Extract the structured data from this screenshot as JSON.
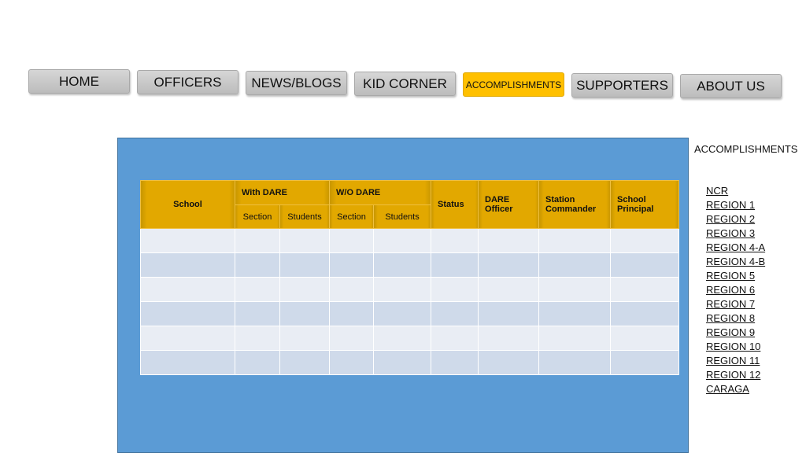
{
  "nav": {
    "items": [
      {
        "label": "HOME"
      },
      {
        "label": "OFFICERS"
      },
      {
        "label": "NEWS/BLOGS"
      },
      {
        "label": "KID CORNER"
      },
      {
        "label": "ACCOMPLISHMENTS",
        "active": true
      },
      {
        "label": "SUPPORTERS"
      },
      {
        "label": "ABOUT US"
      }
    ]
  },
  "table": {
    "headers": {
      "school": "School",
      "with_dare": "With DARE",
      "wo_dare": "W/O DARE",
      "section": "Section",
      "students": "Students",
      "status": "Status",
      "dare_officer": "DARE Officer",
      "station_commander": "Station Commander",
      "school_principal": "School Principal"
    },
    "rows": [
      [
        "",
        "",
        "",
        "",
        "",
        "",
        "",
        "",
        ""
      ],
      [
        "",
        "",
        "",
        "",
        "",
        "",
        "",
        "",
        ""
      ],
      [
        "",
        "",
        "",
        "",
        "",
        "",
        "",
        "",
        ""
      ],
      [
        "",
        "",
        "",
        "",
        "",
        "",
        "",
        "",
        ""
      ],
      [
        "",
        "",
        "",
        "",
        "",
        "",
        "",
        "",
        ""
      ],
      [
        "",
        "",
        "",
        "",
        "",
        "",
        "",
        "",
        ""
      ]
    ]
  },
  "sidebar": {
    "title": "ACCOMPLISHMENTS",
    "regions": [
      "NCR",
      "REGION 1",
      "REGION 2",
      "REGION 3",
      "REGION 4-A",
      "REGION 4-B",
      "REGION 5",
      "REGION 6",
      "REGION 7",
      "REGION 8",
      "REGION 9",
      "REGION 10",
      "REGION 11",
      "REGION 12",
      "CARAGA"
    ]
  },
  "colors": {
    "nav_button": "#c8c8c8",
    "nav_active": "#ffc000",
    "panel": "#5b9bd5",
    "table_header": "#e2a800",
    "row_light": "#e9edf4",
    "row_dark": "#cfdaea"
  }
}
